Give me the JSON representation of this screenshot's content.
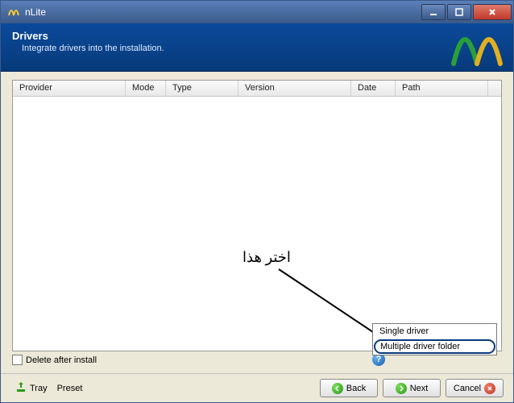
{
  "titlebar": {
    "app_name": "nLite"
  },
  "banner": {
    "title": "Drivers",
    "subtitle": "Integrate drivers into the installation."
  },
  "columns": {
    "provider": "Provider",
    "mode": "Mode",
    "type": "Type",
    "version": "Version",
    "date": "Date",
    "path": "Path"
  },
  "checkbox": {
    "delete_after_install": "Delete after install"
  },
  "help_glyph": "?",
  "menu": {
    "single": "Single driver",
    "multiple": "Multiple driver folder"
  },
  "footer": {
    "tray": "Tray",
    "preset": "Preset",
    "back": "Back",
    "next": "Next",
    "cancel": "Cancel"
  },
  "annotation": {
    "text": "اختر هذا"
  }
}
